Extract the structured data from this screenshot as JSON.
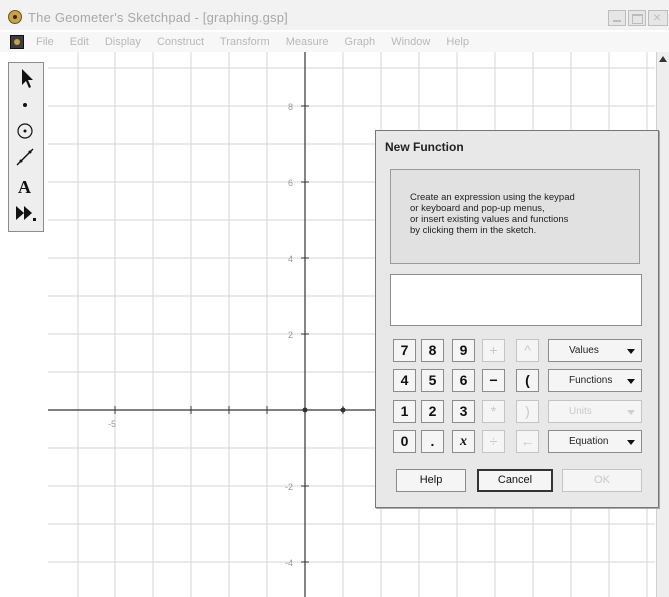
{
  "window": {
    "title": "The Geometer's Sketchpad - [graphing.gsp]"
  },
  "menu": {
    "items": [
      "File",
      "Edit",
      "Display",
      "Construct",
      "Transform",
      "Measure",
      "Graph",
      "Window",
      "Help"
    ]
  },
  "toolbox": {
    "tools": [
      "selection-arrow-icon",
      "point-icon",
      "compass-icon",
      "straightedge-icon",
      "text-icon",
      "custom-tool-icon"
    ]
  },
  "graph": {
    "y_labels": [
      "8",
      "6",
      "4",
      "2",
      "-2",
      "-4"
    ],
    "x_labels": [
      "-5"
    ]
  },
  "dialog": {
    "title": "New Function",
    "instructions": "Create an expression using the keypad\nor keyboard and pop-up menus,\nor insert existing values and functions\nby clicking them in the sketch.",
    "expression": "",
    "keys": {
      "k7": "7",
      "k8": "8",
      "k9": "9",
      "plus": "+",
      "caret": "^",
      "k4": "4",
      "k5": "5",
      "k6": "6",
      "minus": "−",
      "lparen": "(",
      "k1": "1",
      "k2": "2",
      "k3": "3",
      "times": "*",
      "rparen": ")",
      "k0": "0",
      "dot": ".",
      "x": "x",
      "divide": "÷",
      "backspace": "←"
    },
    "dropdowns": {
      "values": "Values",
      "functions": "Functions",
      "units": "Units",
      "equation": "Equation"
    },
    "buttons": {
      "help": "Help",
      "cancel": "Cancel",
      "ok": "OK"
    }
  }
}
